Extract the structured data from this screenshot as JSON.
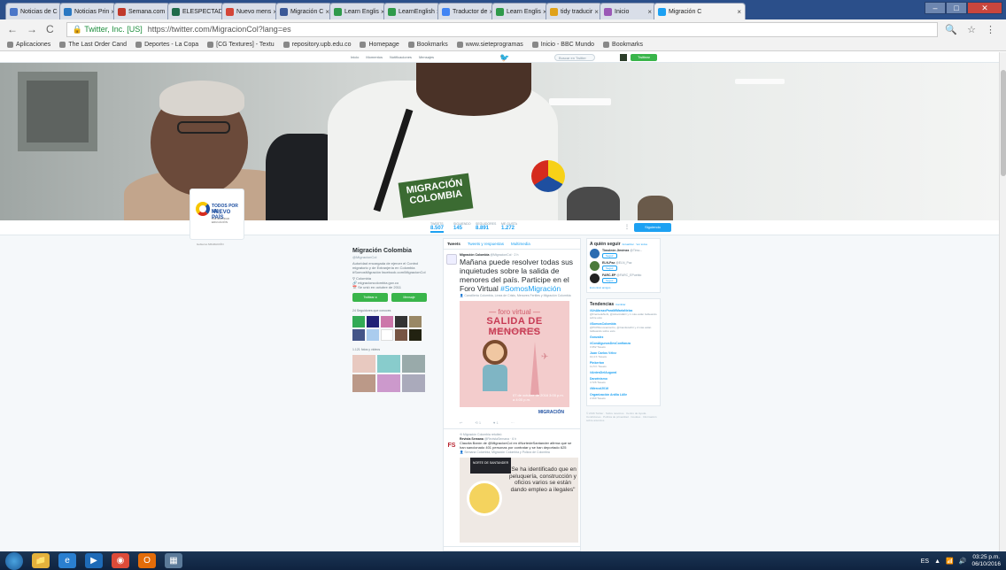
{
  "browser": {
    "tabs": [
      {
        "title": "Noticias de C",
        "color": "#4a76c8"
      },
      {
        "title": "Noticias Prin",
        "color": "#2a78c2"
      },
      {
        "title": "Semana.com",
        "color": "#c0392b"
      },
      {
        "title": "ELESPECTAD",
        "color": "#1f6b4a"
      },
      {
        "title": "Nuevo mens",
        "color": "#d44638"
      },
      {
        "title": "Migración C",
        "color": "#3b5998"
      },
      {
        "title": "Learn Englis",
        "color": "#2f9a4b"
      },
      {
        "title": "LearnEnglish",
        "color": "#2f9a4b"
      },
      {
        "title": "Traductor de",
        "color": "#4285f4"
      },
      {
        "title": "Learn Englis",
        "color": "#2f9a4b"
      },
      {
        "title": "tidy traducir",
        "color": "#e0a21a"
      },
      {
        "title": "Inicio",
        "color": "#9b59b6"
      },
      {
        "title": "Migración C",
        "color": "#1da1f2",
        "active": true
      }
    ],
    "window_buttons": {
      "minimize": "–",
      "maximize": "□",
      "close": "✕"
    },
    "nav": {
      "back": "←",
      "forward": "→",
      "reload": "C"
    },
    "site_identity": "Twitter, Inc. [US]",
    "url": "https://twitter.com/MigracionCol?lang=es",
    "omni_icons": "🔍 ☆ ⋮",
    "bookmarks": [
      "Aplicaciones",
      "The Last Order Cand",
      "Deportes - La Copa",
      "[CG Textures] - Textu",
      "repository.upb.edu.co",
      "Homepage",
      "Bookmarks",
      "www.sieteprogramas",
      "Inicio - BBC Mundo",
      "Bookmarks"
    ]
  },
  "twitter": {
    "topnav": [
      "Inicio",
      "Momentos",
      "Notificaciones",
      "Mensajes"
    ],
    "search_placeholder": "Buscar en Twitter",
    "tweet_button": "Twittear",
    "logo": {
      "line1": "TODOS POR UN",
      "line2": "NUEVO PAÍS",
      "sub": "PAZ EQUIDAD EDUCACIÓN",
      "footer": "Gobierno   MIGRACIÓN"
    },
    "banner_badge": "MIGRACIÓN COLOMBIA",
    "stats": [
      {
        "label": "Tweets",
        "value": "8.507",
        "active": true
      },
      {
        "label": "Siguiendo",
        "value": "145"
      },
      {
        "label": "Seguidores",
        "value": "8.891"
      },
      {
        "label": "Me gusta",
        "value": "1.272"
      }
    ],
    "stats_more": "⋮",
    "follow_button": "Siguiendo",
    "profile": {
      "name": "Migración Colombia",
      "handle": "@MigracionCol",
      "bio": "Autoridad encargada de ejercer el Control migratorio y de Extranjería en Colombia #SomosMigración facebook.com/MigracionCol",
      "location": "Colombia",
      "website": "migracioncolombia.gov.co",
      "joined": "Se unió en octubre de 2011",
      "btn_tweet": "Twittear a",
      "btn_message": "Mensaje",
      "followers_you_know": "24 Seguidores que conoces",
      "photos_videos": "1.121 fotos y videos"
    },
    "timeline_tabs": [
      "Tweets",
      "Tweets y respuestas",
      "Multimedia"
    ],
    "tweets": [
      {
        "author": "Migración Colombia",
        "handle": "@MigracionCol · 2 h",
        "text": "Mañana puede resolver todas sus inquietudes sobre la salida de menores del país. Participe en el Foro Virtual",
        "hashtag": "#SomosMigración",
        "mentions": "Cancillería Colombia, Línea de Crisis, Menores Fertiles y Migración Colombia",
        "poster": {
          "kicker": "— foro virtual —",
          "title": "SALIDA DE MENORES",
          "subtitle": "Semana de Receso 2016",
          "date": "07 de octubre de 2016 3:00 p.m. a 4:00 p.m.",
          "brand": "MIGRACIÓN"
        },
        "actions": [
          "↩",
          "⟲ 1",
          "♥ 1",
          "···"
        ]
      },
      {
        "context": "Migración Colombia retuiteó",
        "author": "Revista Semana",
        "handle": "@RevistaSemana · 6 h",
        "avatar": "FS",
        "text": "Claudia Barón de @MigracionCol en #NortedeSantander afirma que se han sancionado 401 personas por contratar y se han deportado 625",
        "mentions": "Semana Colombia, Migración Colombia y Policía de Colombia",
        "poster": {
          "ribbon": "NORTE DE SANTANDER",
          "quote": "\"Se ha identificado que en peluquería, construcción y oficios varios se están dando empleo a ilegales\""
        }
      }
    ],
    "who_to_follow": {
      "title": "A quién seguir",
      "links": "Actualizar · Ver todos",
      "users": [
        {
          "name": "Timoleón Jiménez",
          "handle": "@Timo..."
        },
        {
          "name": "ELN-Paz",
          "handle": "@ELN_Paz"
        },
        {
          "name": "FARC-EP",
          "handle": "@FARC_EPueblo"
        }
      ],
      "follow": "Seguir",
      "find_friends": "Encontrar amigos"
    },
    "trends": {
      "title": "Tendencias",
      "change": "Cambiar",
      "items": [
        {
          "name": "#UnAbrazoParaMiMariaNelza",
          "count": "@FrentedeNohi, @AlcarciolEO y 1 más están twitteando sobre esto"
        },
        {
          "name": "#SomosColombia",
          "count": "@PCPRenovacionCu, @Camiloturbri y 2 más están twitteando sobre esto"
        },
        {
          "name": "Gonzalez",
          "count": ""
        },
        {
          "name": "#ConAlgunosDesConfianza",
          "count": "3.352 Tweets"
        },
        {
          "name": "Juan Carlos Vélez",
          "count": "10,4 K Tweets"
        },
        {
          "name": "Pinkerton",
          "count": "11,5 K Tweets"
        },
        {
          "name": "#AntesDelAugural",
          "count": ""
        },
        {
          "name": "Darwinismo",
          "count": "4.726 Tweets"
        },
        {
          "name": "#Mercol2016",
          "count": ""
        },
        {
          "name": "Organización Ardila Lülle",
          "count": "2.260 Tweets"
        }
      ]
    },
    "footer": "© 2016 Twitter · Sobre nosotros · Centro de Ayuda · Condiciones · Política de privacidad · Cookies · Información sobre anuncios"
  },
  "taskbar": {
    "apps": [
      {
        "name": "explorer",
        "glyph": "📁",
        "color": "#e3b23c"
      },
      {
        "name": "ie",
        "glyph": "e",
        "color": "#2a7fd0"
      },
      {
        "name": "media",
        "glyph": "▶",
        "color": "#1e6bb8"
      },
      {
        "name": "chrome",
        "glyph": "◉",
        "color": "#dd4b39"
      },
      {
        "name": "office",
        "glyph": "O",
        "color": "#e36c09"
      },
      {
        "name": "calc",
        "glyph": "▦",
        "color": "#5b7a99"
      }
    ],
    "language": "ES",
    "clock_time": "03:25 p.m.",
    "clock_date": "06/10/2016"
  }
}
